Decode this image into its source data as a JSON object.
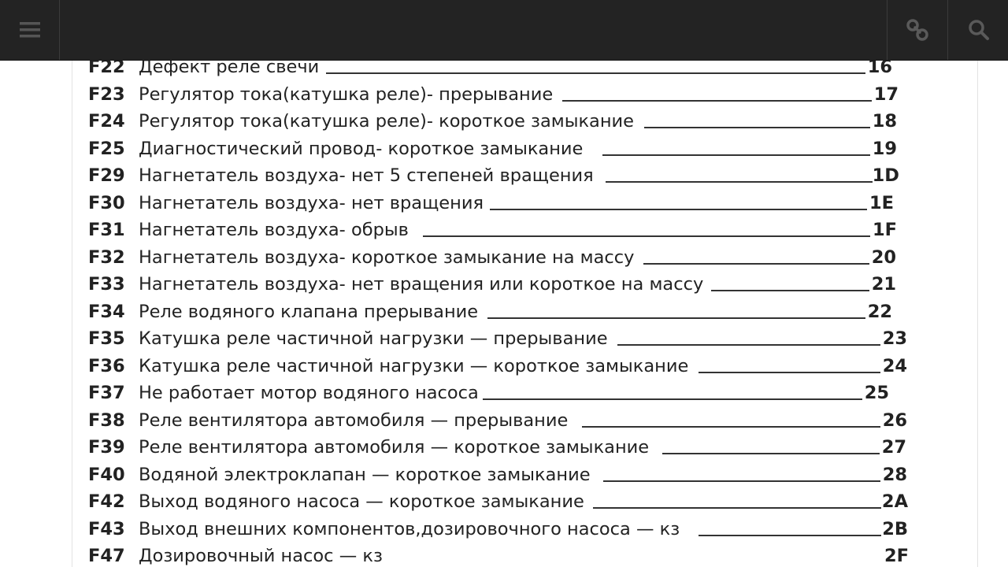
{
  "toolbar": {
    "menu_icon": "hamburger-menu-icon",
    "link_icon": "link-icon",
    "search_icon": "search-icon"
  },
  "colors": {
    "toolbar_bg": "#232323",
    "text": "#222222",
    "page_bg": "#ffffff"
  },
  "entries": [
    {
      "code": "F22",
      "desc": "Дефект реле свечи",
      "page": "16"
    },
    {
      "code": "F23",
      "desc": "Регулятор тока(катушка реле)- прерывание",
      "page": "17"
    },
    {
      "code": "F24",
      "desc": "Регулятор тока(катушка реле)- короткое замыкание",
      "page": "18"
    },
    {
      "code": "F25",
      "desc": "Диагностический провод- короткое замыкание",
      "page": "19"
    },
    {
      "code": "F29",
      "desc": "Нагнетатель воздуха- нет 5 степеней вращения",
      "page": "1D"
    },
    {
      "code": "F30",
      "desc": "Нагнетатель воздуха- нет вращения",
      "page": "1E"
    },
    {
      "code": "F31",
      "desc": "Нагнетатель воздуха- обрыв",
      "page": "1F"
    },
    {
      "code": "F32",
      "desc": "Нагнетатель воздуха- короткое замыкание на массу",
      "page": "20"
    },
    {
      "code": "F33",
      "desc": "Нагнетатель воздуха- нет вращения или короткое на массу",
      "page": "21"
    },
    {
      "code": "F34",
      "desc": "Реле водяного клапана прерывание",
      "page": "22"
    },
    {
      "code": "F35",
      "desc": "Катушка реле частичной нагрузки — прерывание",
      "page": "23"
    },
    {
      "code": "F36",
      "desc": "Катушка реле частичной нагрузки — короткое замыкание",
      "page": "24"
    },
    {
      "code": "F37",
      "desc": "Не работает мотор водяного насоса",
      "page": "25"
    },
    {
      "code": "F38",
      "desc": "Реле вентилятора автомобиля — прерывание",
      "page": "26"
    },
    {
      "code": "F39",
      "desc": "Реле вентилятора автомобиля — короткое замыкание",
      "page": "27"
    },
    {
      "code": "F40",
      "desc": "Водяной электроклапан — короткое замыкание",
      "page": "28"
    },
    {
      "code": "F42",
      "desc": "Выход водяного насоса — короткое замыкание",
      "page": "2A"
    },
    {
      "code": "F43",
      "desc": "Выход внешних компонентов,дозировочного насоса — кз",
      "page": "2B"
    },
    {
      "code": "F47",
      "desc": "Дозировочный насос — кз",
      "page": "2F"
    }
  ]
}
